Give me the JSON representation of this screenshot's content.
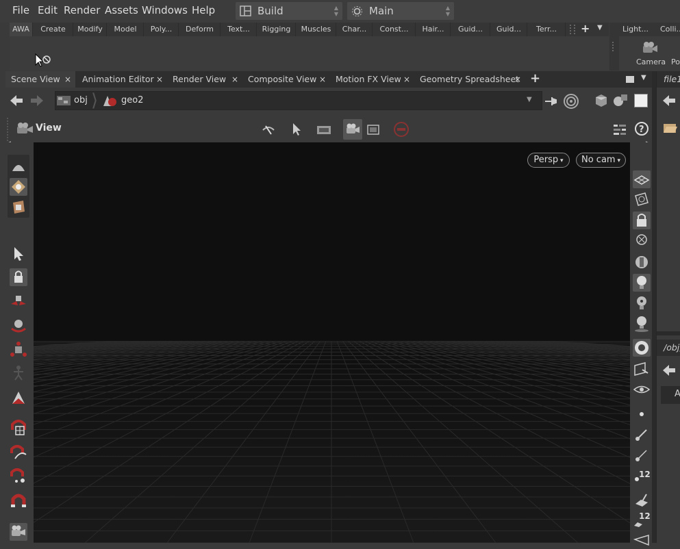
{
  "menubar": {
    "items": [
      "File",
      "Edit",
      "Render",
      "Assets",
      "Windows",
      "Help"
    ],
    "desktop_dropdown": "Build",
    "context_dropdown": "Main"
  },
  "shelf": {
    "tabs": [
      "AWA",
      "Create",
      "Modify",
      "Model",
      "Poly...",
      "Deform",
      "Text...",
      "Rigging",
      "Muscles",
      "Char...",
      "Const...",
      "Hair...",
      "Guid...",
      "Guid...",
      "Terr..."
    ],
    "right_tabs": [
      "Light...",
      "Colli..."
    ],
    "right_tools": [
      "Camera",
      "Po"
    ]
  },
  "pane_tabs": [
    {
      "label": "Scene View",
      "active": true
    },
    {
      "label": "Animation Editor",
      "active": false
    },
    {
      "label": "Render View",
      "active": false
    },
    {
      "label": "Composite View",
      "active": false
    },
    {
      "label": "Motion FX View",
      "active": false
    },
    {
      "label": "Geometry Spreadsheet",
      "active": false
    }
  ],
  "path": {
    "root": "obj",
    "node": "geo2"
  },
  "view_toolbar": {
    "title": "View"
  },
  "viewport": {
    "projection_menu": "Persp",
    "camera_menu": "No cam"
  },
  "right_panel": {
    "top_label": "file1",
    "mid_label": "/obj,",
    "letter": "A"
  },
  "right_toolbar": {
    "label_1": "12",
    "label_2": "12"
  },
  "colors": {
    "accent_red": "#b22b2b",
    "viewport_bg": "#0f0f0f"
  }
}
